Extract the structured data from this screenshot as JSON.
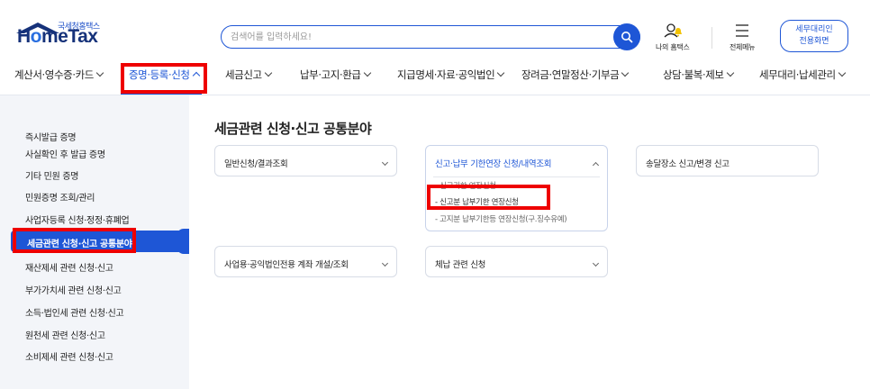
{
  "logo": {
    "sub": "국세청홈택스",
    "main_prefix": "H",
    "main_o": "o",
    "main_suffix": "meTax"
  },
  "search": {
    "placeholder": "검색어를 입력하세요!"
  },
  "util": {
    "my_label": "나의 홈택스",
    "menu_label": "전체메뉴"
  },
  "agent_button": {
    "line1": "세무대리인",
    "line2": "전용화면"
  },
  "nav": [
    {
      "label": "계산서·영수증·카드"
    },
    {
      "label": "증명·등록·신청"
    },
    {
      "label": "세금신고"
    },
    {
      "label": "납부·고지·환급"
    },
    {
      "label": "지급명세·자료·공익법인"
    },
    {
      "label": "장려금·연말정산·기부금"
    },
    {
      "label": "상담·불복·제보"
    },
    {
      "label": "세무대리·납세관리"
    }
  ],
  "sidebar": [
    {
      "label": "즉시발급 증명"
    },
    {
      "label": "사실확인 후 발급 증명"
    },
    {
      "label": "기타 민원 증명"
    },
    {
      "label": "민원증명 조회/관리"
    },
    {
      "label": "사업자등록 신청·정정·휴폐업"
    },
    {
      "label": "세금관련 신청·신고 공통분야"
    },
    {
      "label": "재산제세 관련 신청·신고"
    },
    {
      "label": "부가가치세 관련 신청·신고"
    },
    {
      "label": "소득·법인세 관련 신청·신고"
    },
    {
      "label": "원천세 관련 신청·신고"
    },
    {
      "label": "소비제세 관련 신청·신고"
    }
  ],
  "main": {
    "title": "세금관련 신청·신고 공통분야",
    "cards": [
      {
        "title": "일반신청/결과조회"
      },
      {
        "title": "신고·납부 기한연장 신청/내역조회",
        "items": [
          {
            "label": "- 신고기한 연장신청"
          },
          {
            "label": "- 신고분 납부기한 연장신청"
          },
          {
            "label": "- 고지분 납부기한등 연장신청(구.징수유예)"
          }
        ]
      },
      {
        "title": "송달장소 신고/변경 신고"
      },
      {
        "title": "사업용·공익법인전용 계좌 개설/조회"
      },
      {
        "title": "체납 관련 신청"
      }
    ]
  },
  "colors": {
    "accent": "#1e56d6",
    "highlight": "#ee0000",
    "sidebar_bg": "#f3f5f9"
  }
}
